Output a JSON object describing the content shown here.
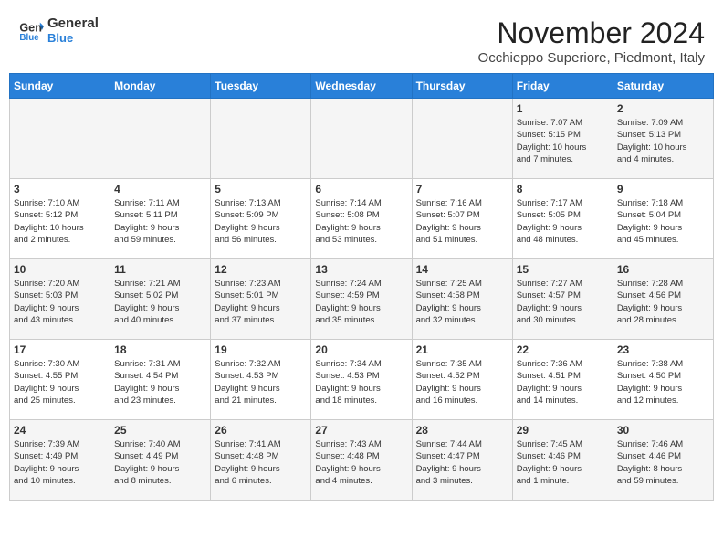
{
  "header": {
    "logo_line1": "General",
    "logo_line2": "Blue",
    "month": "November 2024",
    "location": "Occhieppo Superiore, Piedmont, Italy"
  },
  "weekdays": [
    "Sunday",
    "Monday",
    "Tuesday",
    "Wednesday",
    "Thursday",
    "Friday",
    "Saturday"
  ],
  "weeks": [
    [
      {
        "day": "",
        "info": ""
      },
      {
        "day": "",
        "info": ""
      },
      {
        "day": "",
        "info": ""
      },
      {
        "day": "",
        "info": ""
      },
      {
        "day": "",
        "info": ""
      },
      {
        "day": "1",
        "info": "Sunrise: 7:07 AM\nSunset: 5:15 PM\nDaylight: 10 hours\nand 7 minutes."
      },
      {
        "day": "2",
        "info": "Sunrise: 7:09 AM\nSunset: 5:13 PM\nDaylight: 10 hours\nand 4 minutes."
      }
    ],
    [
      {
        "day": "3",
        "info": "Sunrise: 7:10 AM\nSunset: 5:12 PM\nDaylight: 10 hours\nand 2 minutes."
      },
      {
        "day": "4",
        "info": "Sunrise: 7:11 AM\nSunset: 5:11 PM\nDaylight: 9 hours\nand 59 minutes."
      },
      {
        "day": "5",
        "info": "Sunrise: 7:13 AM\nSunset: 5:09 PM\nDaylight: 9 hours\nand 56 minutes."
      },
      {
        "day": "6",
        "info": "Sunrise: 7:14 AM\nSunset: 5:08 PM\nDaylight: 9 hours\nand 53 minutes."
      },
      {
        "day": "7",
        "info": "Sunrise: 7:16 AM\nSunset: 5:07 PM\nDaylight: 9 hours\nand 51 minutes."
      },
      {
        "day": "8",
        "info": "Sunrise: 7:17 AM\nSunset: 5:05 PM\nDaylight: 9 hours\nand 48 minutes."
      },
      {
        "day": "9",
        "info": "Sunrise: 7:18 AM\nSunset: 5:04 PM\nDaylight: 9 hours\nand 45 minutes."
      }
    ],
    [
      {
        "day": "10",
        "info": "Sunrise: 7:20 AM\nSunset: 5:03 PM\nDaylight: 9 hours\nand 43 minutes."
      },
      {
        "day": "11",
        "info": "Sunrise: 7:21 AM\nSunset: 5:02 PM\nDaylight: 9 hours\nand 40 minutes."
      },
      {
        "day": "12",
        "info": "Sunrise: 7:23 AM\nSunset: 5:01 PM\nDaylight: 9 hours\nand 37 minutes."
      },
      {
        "day": "13",
        "info": "Sunrise: 7:24 AM\nSunset: 4:59 PM\nDaylight: 9 hours\nand 35 minutes."
      },
      {
        "day": "14",
        "info": "Sunrise: 7:25 AM\nSunset: 4:58 PM\nDaylight: 9 hours\nand 32 minutes."
      },
      {
        "day": "15",
        "info": "Sunrise: 7:27 AM\nSunset: 4:57 PM\nDaylight: 9 hours\nand 30 minutes."
      },
      {
        "day": "16",
        "info": "Sunrise: 7:28 AM\nSunset: 4:56 PM\nDaylight: 9 hours\nand 28 minutes."
      }
    ],
    [
      {
        "day": "17",
        "info": "Sunrise: 7:30 AM\nSunset: 4:55 PM\nDaylight: 9 hours\nand 25 minutes."
      },
      {
        "day": "18",
        "info": "Sunrise: 7:31 AM\nSunset: 4:54 PM\nDaylight: 9 hours\nand 23 minutes."
      },
      {
        "day": "19",
        "info": "Sunrise: 7:32 AM\nSunset: 4:53 PM\nDaylight: 9 hours\nand 21 minutes."
      },
      {
        "day": "20",
        "info": "Sunrise: 7:34 AM\nSunset: 4:53 PM\nDaylight: 9 hours\nand 18 minutes."
      },
      {
        "day": "21",
        "info": "Sunrise: 7:35 AM\nSunset: 4:52 PM\nDaylight: 9 hours\nand 16 minutes."
      },
      {
        "day": "22",
        "info": "Sunrise: 7:36 AM\nSunset: 4:51 PM\nDaylight: 9 hours\nand 14 minutes."
      },
      {
        "day": "23",
        "info": "Sunrise: 7:38 AM\nSunset: 4:50 PM\nDaylight: 9 hours\nand 12 minutes."
      }
    ],
    [
      {
        "day": "24",
        "info": "Sunrise: 7:39 AM\nSunset: 4:49 PM\nDaylight: 9 hours\nand 10 minutes."
      },
      {
        "day": "25",
        "info": "Sunrise: 7:40 AM\nSunset: 4:49 PM\nDaylight: 9 hours\nand 8 minutes."
      },
      {
        "day": "26",
        "info": "Sunrise: 7:41 AM\nSunset: 4:48 PM\nDaylight: 9 hours\nand 6 minutes."
      },
      {
        "day": "27",
        "info": "Sunrise: 7:43 AM\nSunset: 4:48 PM\nDaylight: 9 hours\nand 4 minutes."
      },
      {
        "day": "28",
        "info": "Sunrise: 7:44 AM\nSunset: 4:47 PM\nDaylight: 9 hours\nand 3 minutes."
      },
      {
        "day": "29",
        "info": "Sunrise: 7:45 AM\nSunset: 4:46 PM\nDaylight: 9 hours\nand 1 minute."
      },
      {
        "day": "30",
        "info": "Sunrise: 7:46 AM\nSunset: 4:46 PM\nDaylight: 8 hours\nand 59 minutes."
      }
    ]
  ]
}
